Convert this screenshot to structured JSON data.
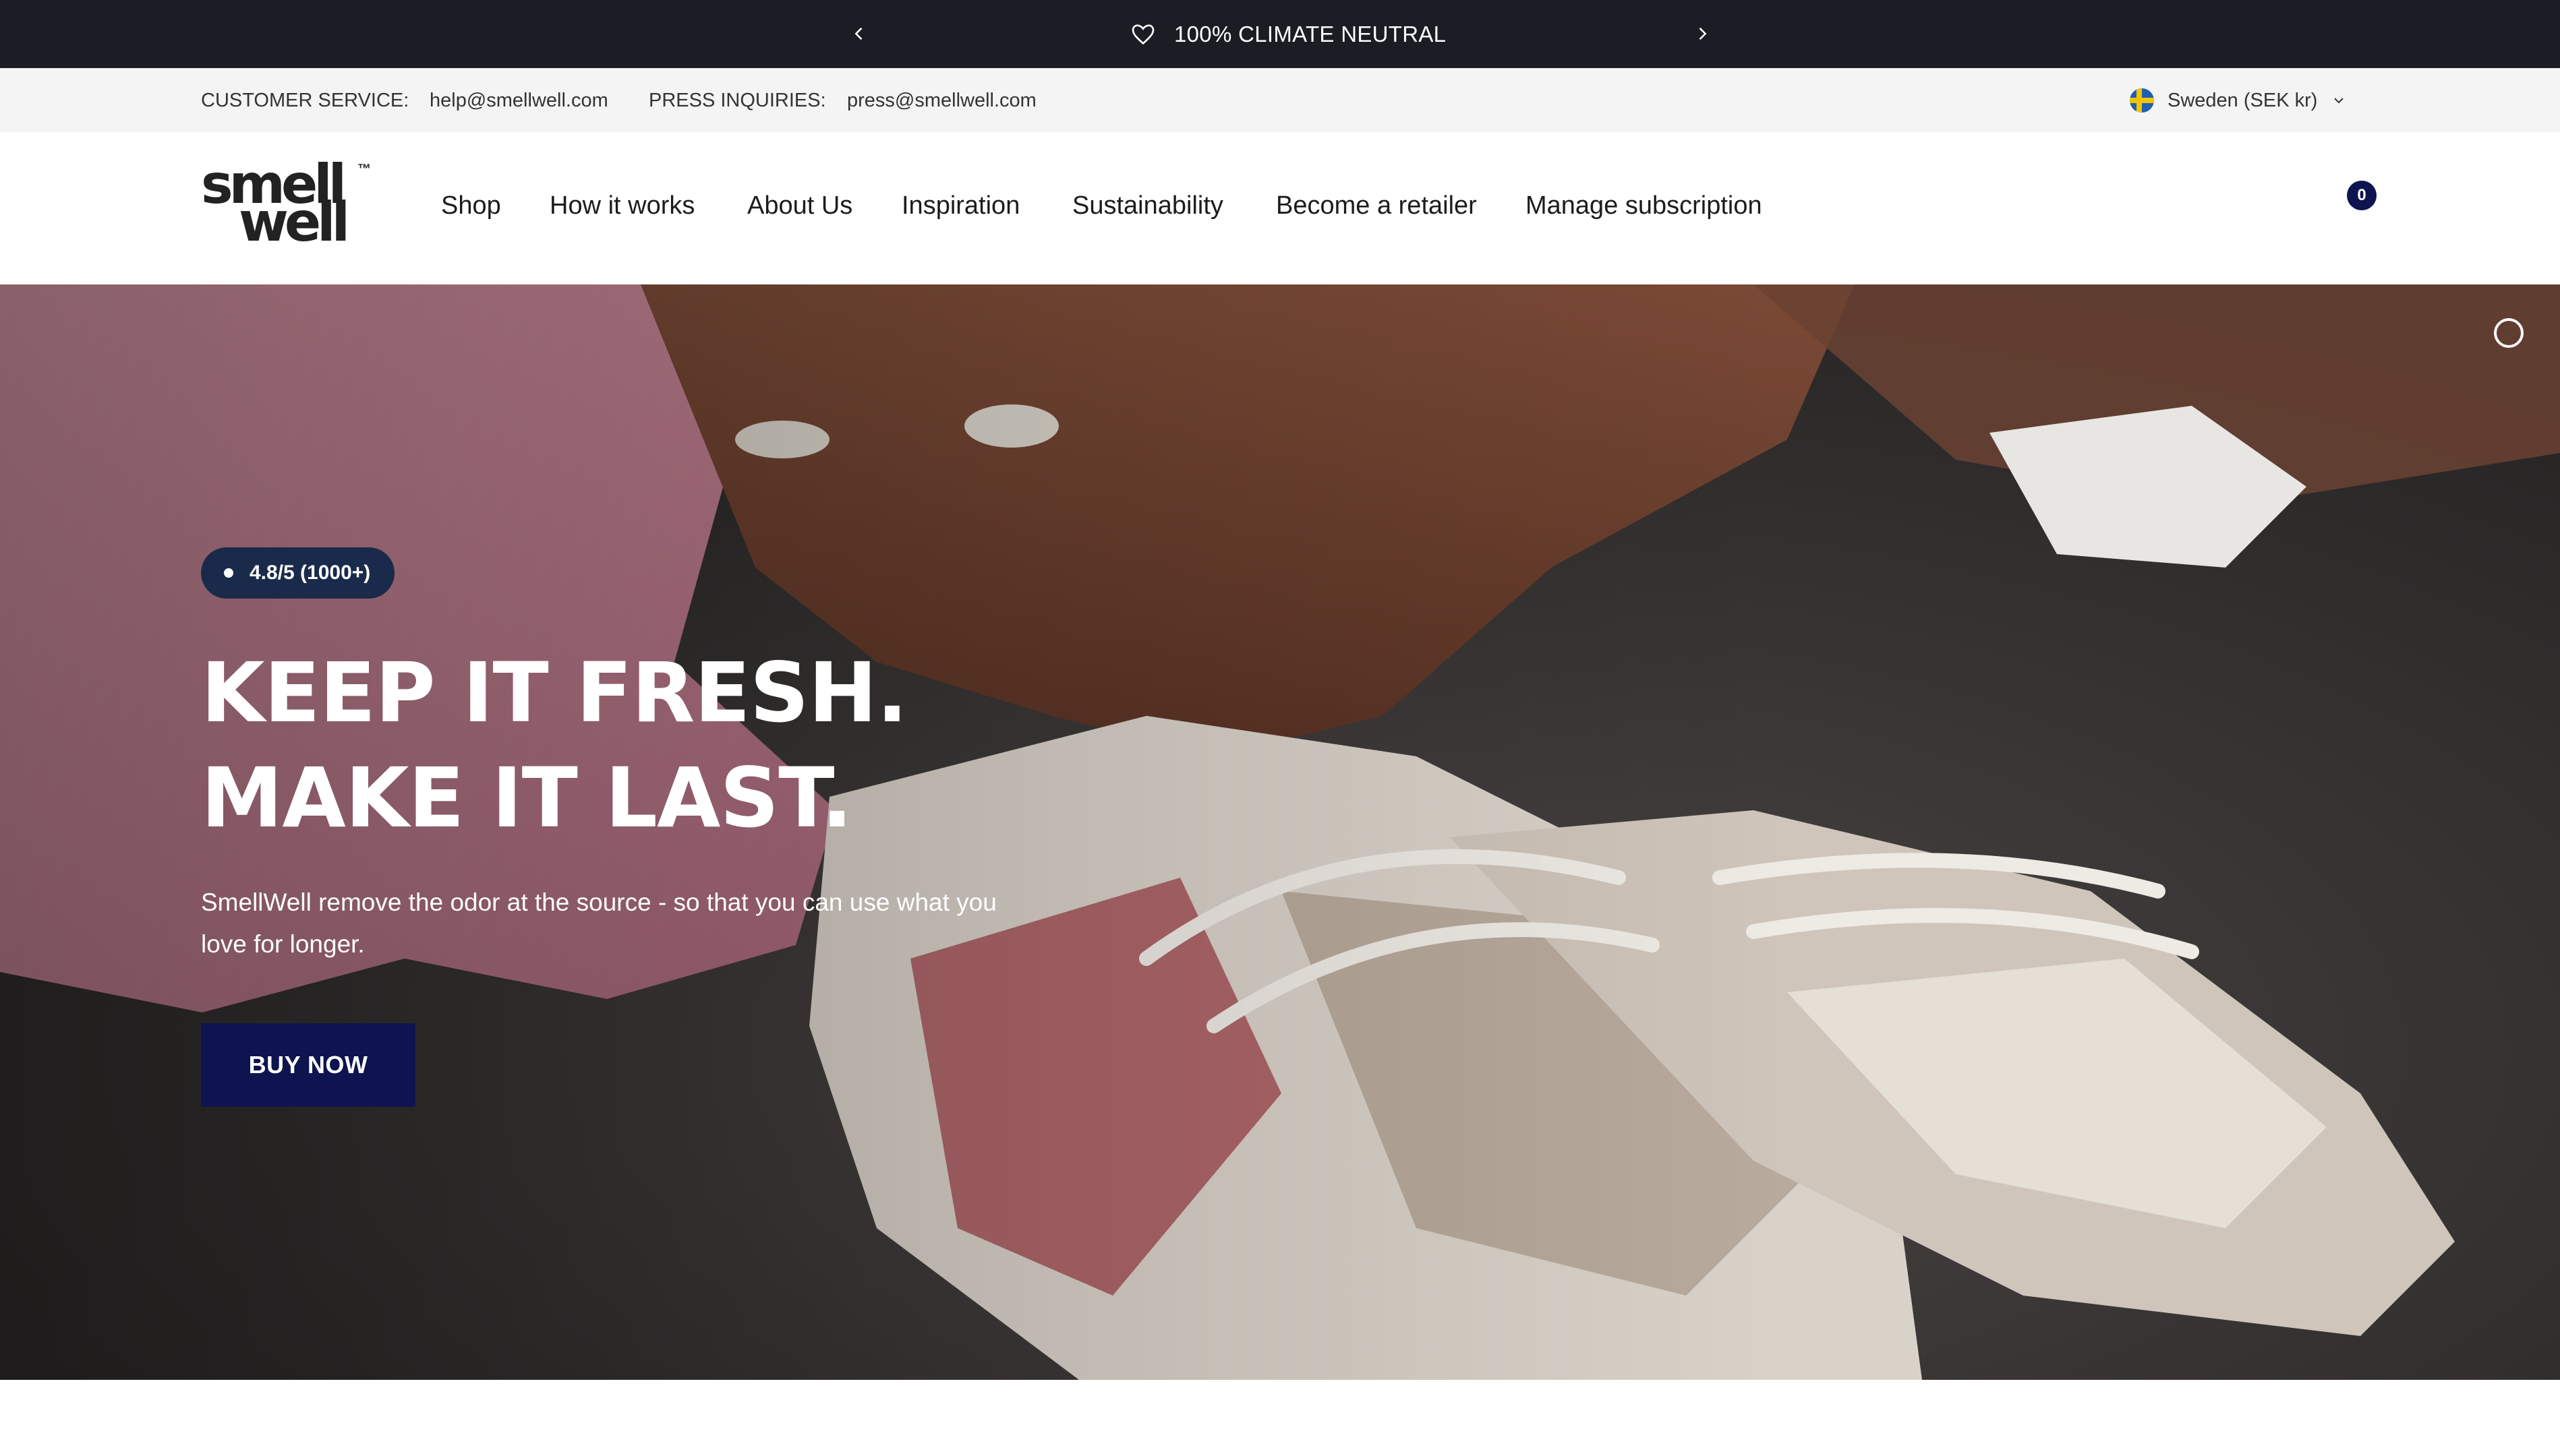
{
  "announcement": {
    "text": "100% CLIMATE NEUTRAL",
    "icon": "heart-icon",
    "prev_icon": "chevron-left-icon",
    "next_icon": "chevron-right-icon",
    "background": "#1b1c24"
  },
  "infobar": {
    "customer_service_label": "CUSTOMER SERVICE:",
    "customer_service_email": "help@smellwell.com",
    "press_label": "PRESS INQUIRIES:",
    "press_email": "press@smellwell.com",
    "country": "Sweden (SEK kr)",
    "country_icon": "sweden-flag-icon"
  },
  "header": {
    "logo_line1": "smell",
    "logo_line2": "well",
    "logo_tm": "™",
    "nav": [
      {
        "label": "Shop"
      },
      {
        "label": "How it works"
      },
      {
        "label": "About Us"
      },
      {
        "label": "Inspiration"
      },
      {
        "label": "Sustainability"
      },
      {
        "label": "Become a retailer"
      },
      {
        "label": "Manage subscription"
      }
    ],
    "cart_count": "0"
  },
  "hero": {
    "rating": "4.8/5 (1000+)",
    "headline_line1": "KEEP IT FRESH.",
    "headline_line2": "MAKE IT LAST.",
    "subtext": "SmellWell remove the odor at the source - so that you can use what you love for longer.",
    "cta": "BUY NOW",
    "accent": "#0e1450"
  }
}
